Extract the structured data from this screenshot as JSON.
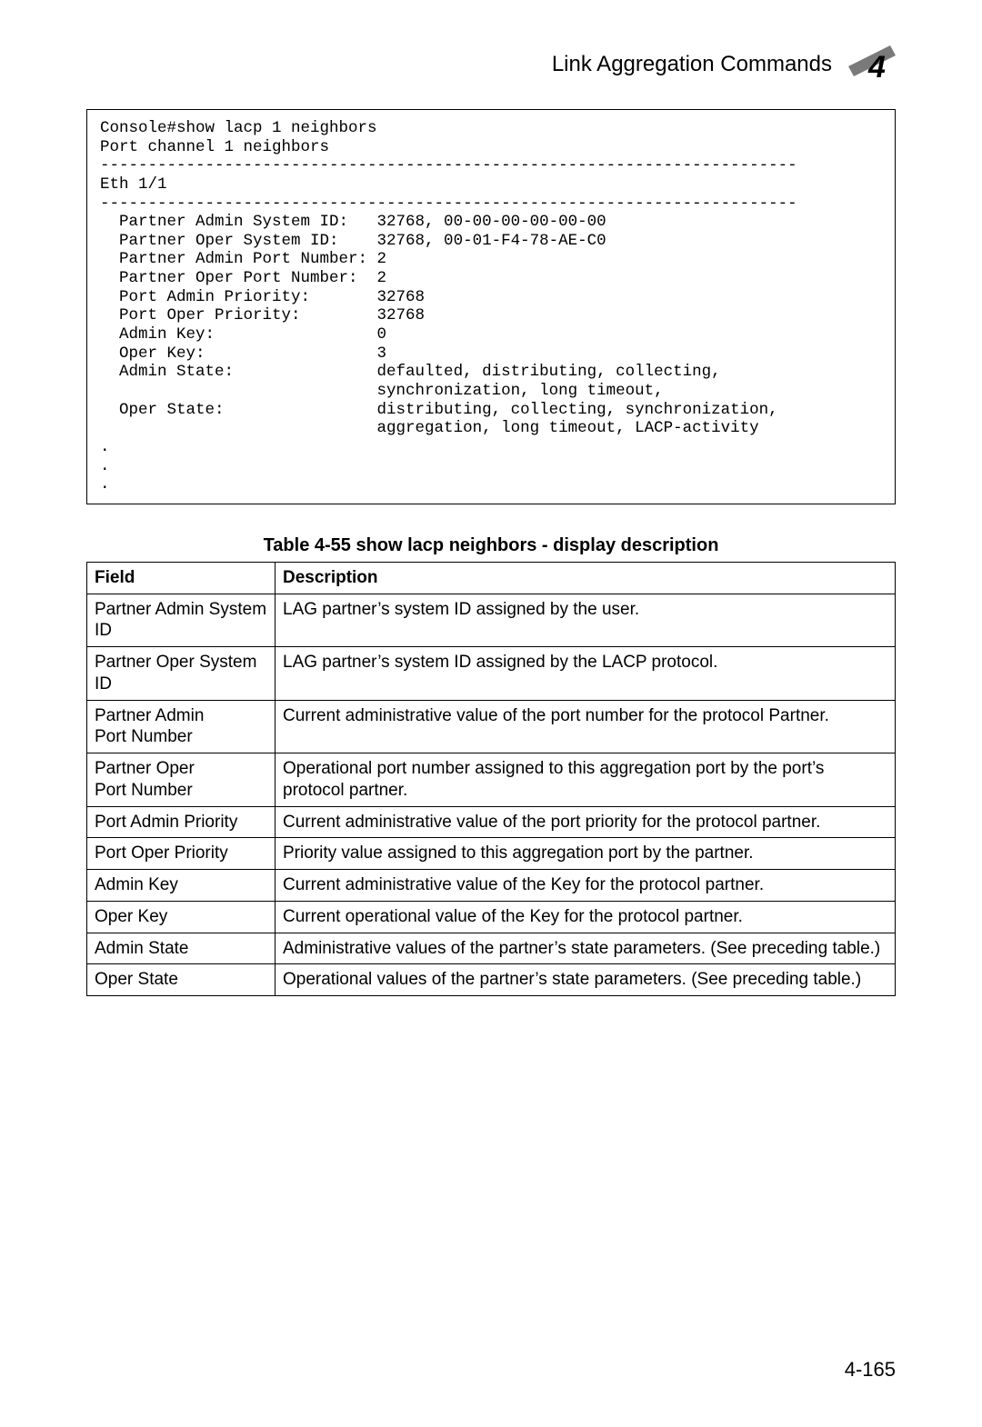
{
  "header": {
    "title": "Link Aggregation Commands",
    "chapter_number": "4"
  },
  "console": {
    "lines": [
      "Console#show lacp 1 neighbors",
      "Port channel 1 neighbors",
      "-------------------------------------------------------------------------",
      "Eth 1/1",
      "-------------------------------------------------------------------------",
      "  Partner Admin System ID:   32768, 00-00-00-00-00-00",
      "  Partner Oper System ID:    32768, 00-01-F4-78-AE-C0",
      "  Partner Admin Port Number: 2",
      "  Partner Oper Port Number:  2",
      "  Port Admin Priority:       32768",
      "  Port Oper Priority:        32768",
      "  Admin Key:                 0",
      "  Oper Key:                  3",
      "  Admin State:               defaulted, distributing, collecting,",
      "                             synchronization, long timeout,",
      "  Oper State:                distributing, collecting, synchronization,",
      "                             aggregation, long timeout, LACP-activity"
    ]
  },
  "table": {
    "caption": "Table 4-55   show lacp neighbors - display description",
    "head_field": "Field",
    "head_desc": "Description",
    "rows": [
      {
        "field": "Partner Admin System ID",
        "desc": "LAG partner’s system ID assigned by the user."
      },
      {
        "field": "Partner Oper System ID",
        "desc": "LAG partner’s system ID assigned by the LACP protocol."
      },
      {
        "field": "Partner Admin Port Number",
        "desc": "Current administrative value of the port number for the protocol Partner."
      },
      {
        "field": "Partner Oper Port Number",
        "desc": "Operational port number assigned to this aggregation port by the port’s protocol partner."
      },
      {
        "field": "Port Admin Priority",
        "desc": "Current administrative value of the port priority for the protocol partner."
      },
      {
        "field": "Port Oper Priority",
        "desc": "Priority value assigned to this aggregation port by the partner."
      },
      {
        "field": "Admin Key",
        "desc": "Current administrative value of the Key for the protocol partner."
      },
      {
        "field": "Oper Key",
        "desc": "Current operational value of the Key for the protocol partner."
      },
      {
        "field": "Admin State",
        "desc": "Administrative values of the partner’s state parameters. (See preceding table.)"
      },
      {
        "field": "Oper State",
        "desc": "Operational values of the partner’s state parameters. (See preceding table.)"
      }
    ]
  },
  "page_number": "4-165",
  "chart_data": {
    "type": "table",
    "title": "show lacp neighbors - display description",
    "columns": [
      "Field",
      "Description"
    ],
    "rows": [
      [
        "Partner Admin System ID",
        "LAG partner’s system ID assigned by the user."
      ],
      [
        "Partner Oper System ID",
        "LAG partner’s system ID assigned by the LACP protocol."
      ],
      [
        "Partner Admin Port Number",
        "Current administrative value of the port number for the protocol Partner."
      ],
      [
        "Partner Oper Port Number",
        "Operational port number assigned to this aggregation port by the port’s protocol partner."
      ],
      [
        "Port Admin Priority",
        "Current administrative value of the port priority for the protocol partner."
      ],
      [
        "Port Oper Priority",
        "Priority value assigned to this aggregation port by the partner."
      ],
      [
        "Admin Key",
        "Current administrative value of the Key for the protocol partner."
      ],
      [
        "Oper Key",
        "Current operational value of the Key for the protocol partner."
      ],
      [
        "Admin State",
        "Administrative values of the partner’s state parameters. (See preceding table.)"
      ],
      [
        "Oper State",
        "Operational values of the partner’s state parameters. (See preceding table.)"
      ]
    ]
  }
}
